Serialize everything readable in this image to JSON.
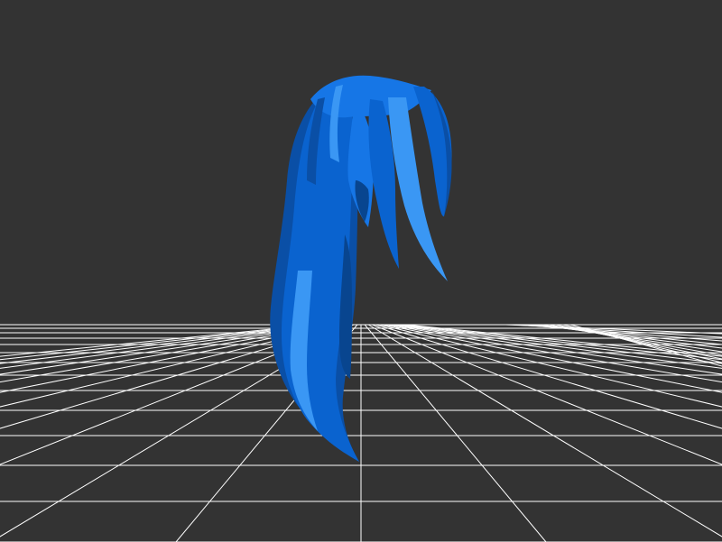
{
  "scene": {
    "background_color": "#333333",
    "grid_color": "#ffffff",
    "grid_visible": true,
    "model": {
      "name": "hair-model",
      "colors": {
        "base": "#0a63cf",
        "mid": "#1676e6",
        "light": "#3a97f4",
        "dark": "#0a4fa6",
        "shadow": "#08458f"
      }
    }
  }
}
